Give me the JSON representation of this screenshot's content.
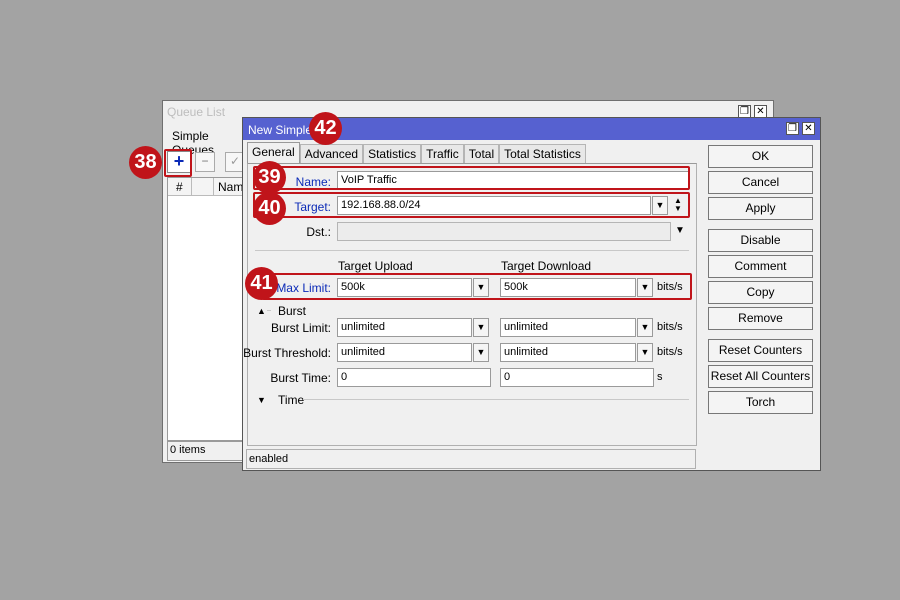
{
  "queue_list": {
    "title": "Queue List",
    "tab": "Simple Queues",
    "add_icon": "plus-icon",
    "remove_icon": "minus-icon",
    "enable_icon": "check-icon",
    "columns": {
      "hash": "#",
      "name": "Name"
    },
    "status": "0 items",
    "title_buttons": {
      "restore": "restore-icon",
      "close": "close-icon"
    }
  },
  "dialog": {
    "title": "New Simple Q",
    "title_buttons": {
      "restore": "restore-icon",
      "close": "close-icon"
    },
    "tabs": [
      "General",
      "Advanced",
      "Statistics",
      "Traffic",
      "Total",
      "Total Statistics"
    ],
    "active_tab": "General",
    "name": {
      "label": "Name:",
      "value": "VoIP Traffic"
    },
    "target": {
      "label": "Target:",
      "value": "192.168.88.0/24"
    },
    "dst": {
      "label": "Dst.:",
      "value": ""
    },
    "headers": {
      "upload": "Target Upload",
      "download": "Target Download"
    },
    "max_limit": {
      "label": "Max Limit:",
      "upload": "500k",
      "download": "500k",
      "unit": "bits/s"
    },
    "burst_section": "Burst",
    "burst_limit": {
      "label": "Burst Limit:",
      "upload": "unlimited",
      "download": "unlimited",
      "unit": "bits/s"
    },
    "burst_threshold": {
      "label": "Burst Threshold:",
      "upload": "unlimited",
      "download": "unlimited",
      "unit": "bits/s"
    },
    "burst_time": {
      "label": "Burst Time:",
      "upload": "0",
      "download": "0",
      "unit": "s"
    },
    "time_section": "Time",
    "status": "enabled",
    "buttons": [
      "OK",
      "Cancel",
      "Apply",
      "Disable",
      "Comment",
      "Copy",
      "Remove",
      "Reset Counters",
      "Reset All Counters",
      "Torch"
    ]
  },
  "annotations": {
    "b38": "38",
    "b39": "39",
    "b40": "40",
    "b41": "41",
    "b42": "42"
  },
  "colors": {
    "accent_red": "#c0141a",
    "titlebar_blue": "#5661d0",
    "link_blue": "#0b2ab7"
  }
}
